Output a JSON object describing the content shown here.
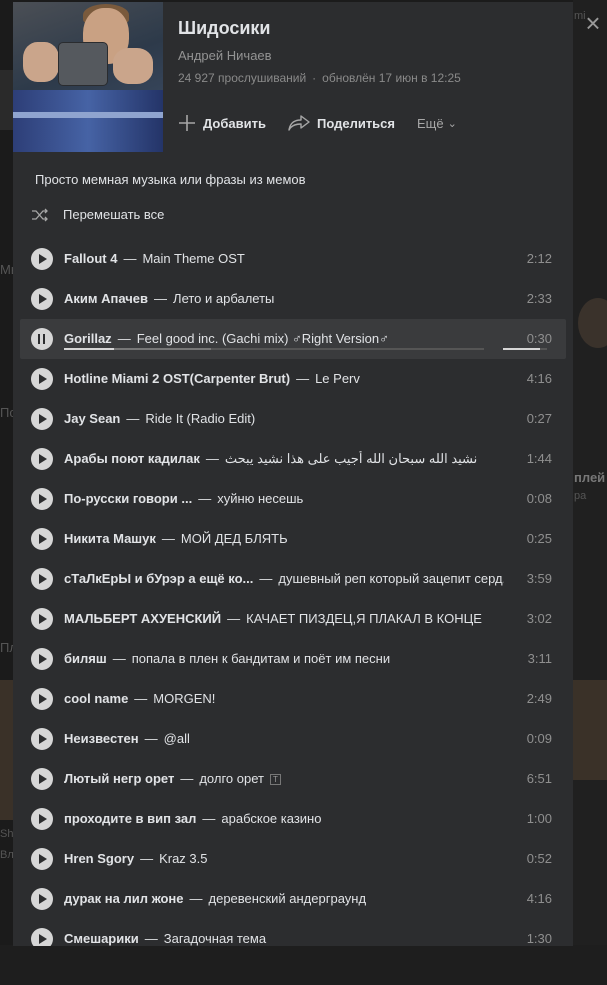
{
  "background": {
    "left_fragments": [
      "Мы",
      "По",
      "Пл",
      "Sh",
      "Вл"
    ],
    "right_fragments": [
      "плей",
      "pa",
      "mi"
    ]
  },
  "playlist": {
    "title": "Шидосики",
    "author": "Андрей Ничаев",
    "plays": "24 927 прослушиваний",
    "updated": "обновлён 17 июн в 12:25",
    "description": "Просто мемная музыка или фразы из мемов",
    "shuffle_label": "Перемешать все"
  },
  "actions": {
    "add": "Добавить",
    "share": "Поделиться",
    "more": "Ещё"
  },
  "player": {
    "active_index": 2,
    "progress_fraction": 0.12,
    "volume_fraction": 0.85
  },
  "tracks": [
    {
      "artist": "Fallout 4",
      "title": "Main Theme OST",
      "duration": "2:12"
    },
    {
      "artist": "Аким Апачев",
      "title": "Лето и арбалеты",
      "duration": "2:33"
    },
    {
      "artist": "Gorillaz",
      "title": "Feel good inc. (Gachi mix) ♂Right Version♂",
      "duration": "0:30"
    },
    {
      "artist": "Hotline Miami 2 OST(Carpenter Brut)",
      "title": "Le Perv",
      "duration": "4:16"
    },
    {
      "artist": "Jay Sean",
      "title": "Ride It (Radio Edit)",
      "duration": "0:27"
    },
    {
      "artist": "Арабы поют кадилак",
      "title": "نشيد الله سبحان الله أجيب على هذا نشيد يبحث",
      "duration": "1:44"
    },
    {
      "artist": "По-русски говори ...",
      "title": "хуйню несешь",
      "duration": "0:08"
    },
    {
      "artist": "Никита Машук",
      "title": "МОЙ ДЕД БЛЯТЬ",
      "duration": "0:25"
    },
    {
      "artist": "сТаЛкЕрЫ и бУрэр а ещё ко...",
      "title": "душевный реп который зацепит серд...",
      "duration": "3:59"
    },
    {
      "artist": "МАЛЬБЕРТ АХУЕНСКИЙ",
      "title": "КАЧАЕТ ПИЗДЕЦ,Я ПЛАКАЛ В КОНЦЕ",
      "duration": "3:02"
    },
    {
      "artist": "биляш",
      "title": "попала в плен к бандитам и поёт им песни",
      "duration": "3:11"
    },
    {
      "artist": "cool name",
      "title": "MORGEN!",
      "duration": "2:49"
    },
    {
      "artist": "Неизвестен",
      "title": "@all",
      "duration": "0:09"
    },
    {
      "artist": "Лютый негр орет",
      "title": "долго орет",
      "duration": "6:51",
      "badge": "T"
    },
    {
      "artist": "проходите в вип зал",
      "title": "арабское казино",
      "duration": "1:00"
    },
    {
      "artist": "Hren Sgory",
      "title": "Kraz 3.5",
      "duration": "0:52"
    },
    {
      "artist": "дурак на лил жоне",
      "title": "деревенский андерграунд",
      "duration": "4:16"
    },
    {
      "artist": "Смешарики",
      "title": "Загадочная тема",
      "duration": "1:30"
    }
  ]
}
